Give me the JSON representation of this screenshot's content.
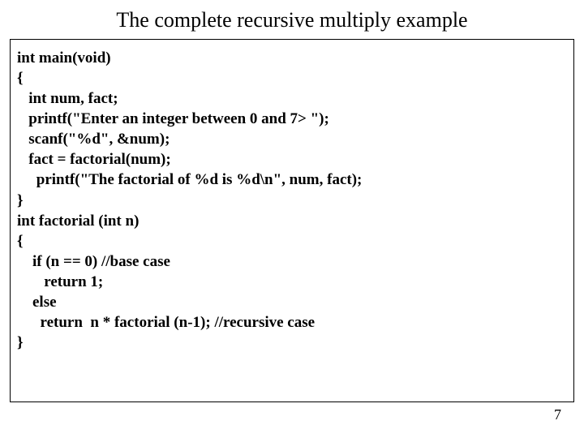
{
  "title": "The complete recursive multiply example",
  "code": {
    "l1": "int main(void)",
    "l2": "{",
    "l3": "   int num, fact;",
    "l4": "   printf(\"Enter an integer between 0 and 7> \");",
    "l5": "   scanf(\"%d\", &num);",
    "l6": "   fact = factorial(num);",
    "l7": "     printf(\"The factorial of %d is %d\\n\", num, fact);",
    "l8": "}",
    "l9": "int factorial (int n)",
    "l10": "{",
    "l11": "    if (n == 0) //base case",
    "l12": "       return 1;",
    "l13": "    else",
    "l14": "      return  n * factorial (n-1); //recursive case",
    "l15": "}"
  },
  "page_number": "7"
}
